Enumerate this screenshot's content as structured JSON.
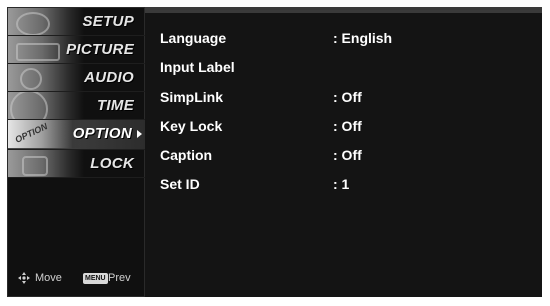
{
  "menu": {
    "items": [
      {
        "label": "SETUP",
        "active": false
      },
      {
        "label": "PICTURE",
        "active": false
      },
      {
        "label": "AUDIO",
        "active": false
      },
      {
        "label": "TIME",
        "active": false
      },
      {
        "label": "OPTION",
        "active": true
      },
      {
        "label": "LOCK",
        "active": false
      }
    ],
    "thumb_text": "OPTION",
    "footer": {
      "move_label": "Move",
      "menu_key": "MENU",
      "prev_label": "Prev"
    }
  },
  "options": [
    {
      "name": "Language",
      "value": ": English"
    },
    {
      "name": "Input Label",
      "value": ""
    },
    {
      "name": "SimpLink",
      "value": ": Off"
    },
    {
      "name": "Key Lock",
      "value": ": Off"
    },
    {
      "name": "Caption",
      "value": ": Off"
    },
    {
      "name": "Set ID",
      "value": ": 1"
    }
  ],
  "colors": {
    "panel_bg": "#141414",
    "text": "#ffffff",
    "active_item": "#4b4b4b"
  }
}
